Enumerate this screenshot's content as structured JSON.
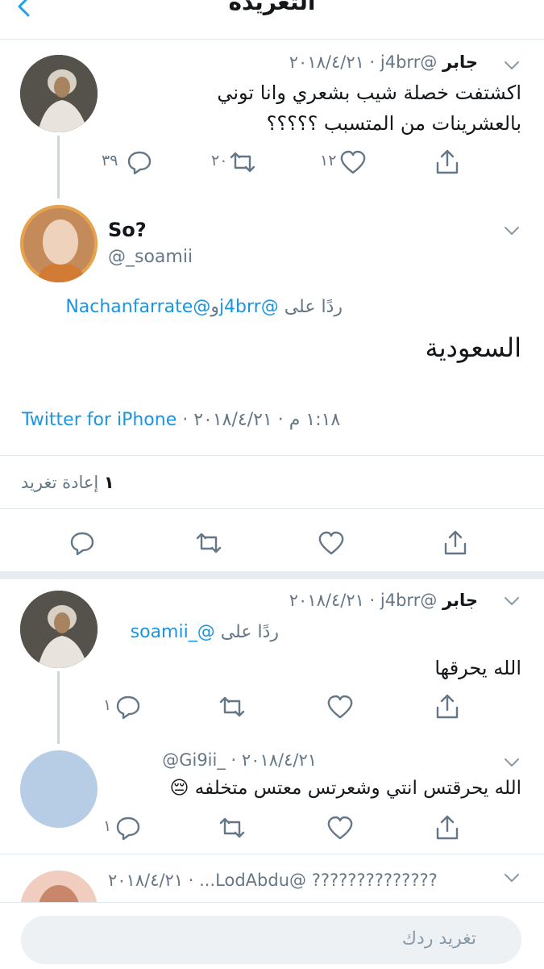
{
  "header": {
    "title": "التغريدة"
  },
  "tweet1": {
    "display_name": "جابر",
    "meta": "@j4brr · ٢٠١٨/٤/٢١",
    "text_line1": "اكشتفت خصلة شيب بشعري وانا توني",
    "text_line2": "بالعشرينات من المتسبب ؟؟؟؟؟",
    "replies": "٣٩",
    "retweets": "٢٠",
    "likes": "١٢"
  },
  "main_tweet": {
    "display_name": "So?",
    "handle": "@_soamii",
    "replying_label": "ردًا على",
    "replying_to1": "@j4brr",
    "replying_conj": "و",
    "replying_to2": "@Nachanfarrate",
    "text": "السعودية",
    "time": "١:١٨ م · ٢٠١٨/٤/٢١ ·",
    "source": "Twitter for iPhone",
    "retweet_count": "١",
    "retweet_label": "إعادة تغريد"
  },
  "reply1": {
    "display_name": "جابر",
    "meta": "@j4brr · ٢٠١٨/٤/٢١",
    "replying_label": "ردًا على",
    "replying_to": "@_soamii",
    "text": "الله يحرقها",
    "replies": "١"
  },
  "reply2": {
    "meta": "@Gi9ii_ · ٢٠١٨/٤/٢١",
    "text": "الله يحرقتس انتي وشعرتس معتس متخلفه 😔",
    "replies": "١"
  },
  "reply3": {
    "meta": "?????????????? @LodAbdu... · ٢٠١٨/٤/٢١"
  },
  "compose": {
    "placeholder": "تغريد ردك"
  }
}
